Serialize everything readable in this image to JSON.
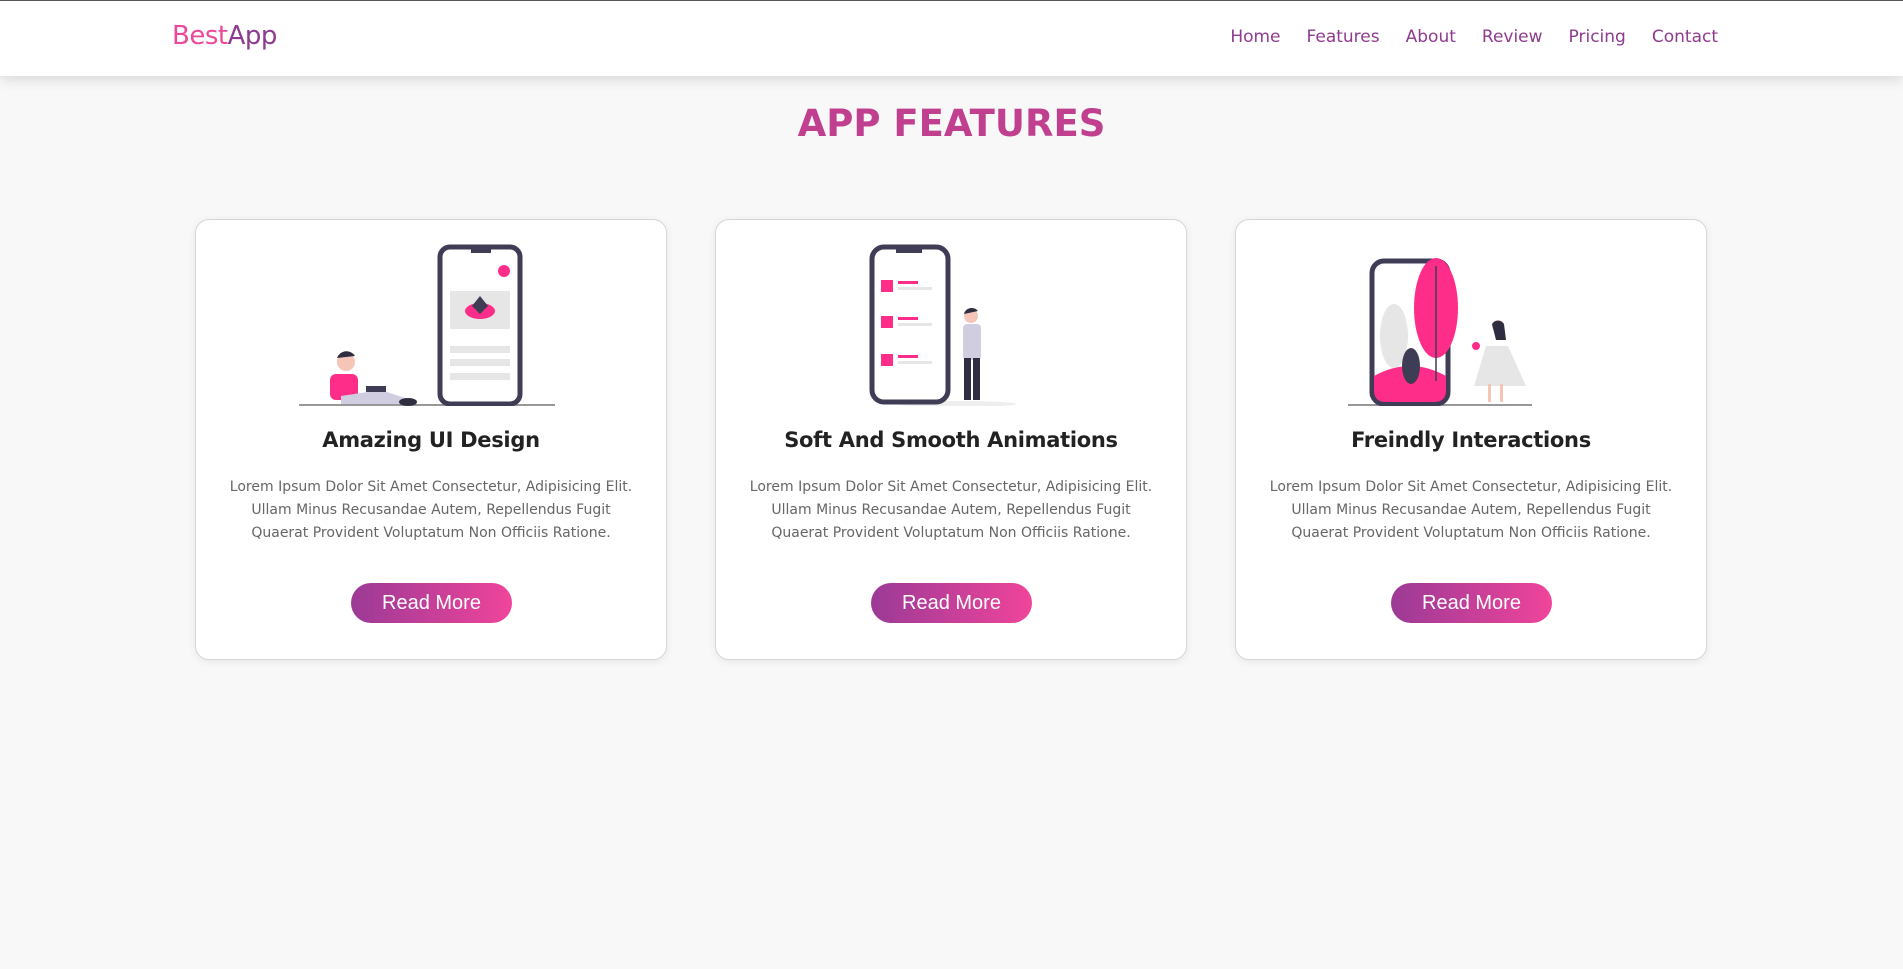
{
  "header": {
    "logo_part1": "Best",
    "logo_part2": "App",
    "nav": [
      "Home",
      "Features",
      "About",
      "Review",
      "Pricing",
      "Contact"
    ]
  },
  "section_title": "APP FEATURES",
  "colors": {
    "accent_pink": "#ec4899",
    "accent_purple": "#8e3b8f",
    "title": "#c0408f"
  },
  "cards": [
    {
      "title": "Amazing UI Design",
      "text": "Lorem Ipsum Dolor Sit Amet Consectetur, Adipisicing Elit. Ullam Minus Recusandae Autem, Repellendus Fugit Quaerat Provident Voluptatum Non Officiis Ratione.",
      "button": "Read More",
      "illustration": "woman-with-laptop-and-phone"
    },
    {
      "title": "Soft And Smooth Animations",
      "text": "Lorem Ipsum Dolor Sit Amet Consectetur, Adipisicing Elit. Ullam Minus Recusandae Autem, Repellendus Fugit Quaerat Provident Voluptatum Non Officiis Ratione.",
      "button": "Read More",
      "illustration": "man-with-phone-list"
    },
    {
      "title": "Freindly Interactions",
      "text": "Lorem Ipsum Dolor Sit Amet Consectetur, Adipisicing Elit. Ullam Minus Recusandae Autem, Repellendus Fugit Quaerat Provident Voluptatum Non Officiis Ratione.",
      "button": "Read More",
      "illustration": "woman-with-phone-plants"
    }
  ]
}
